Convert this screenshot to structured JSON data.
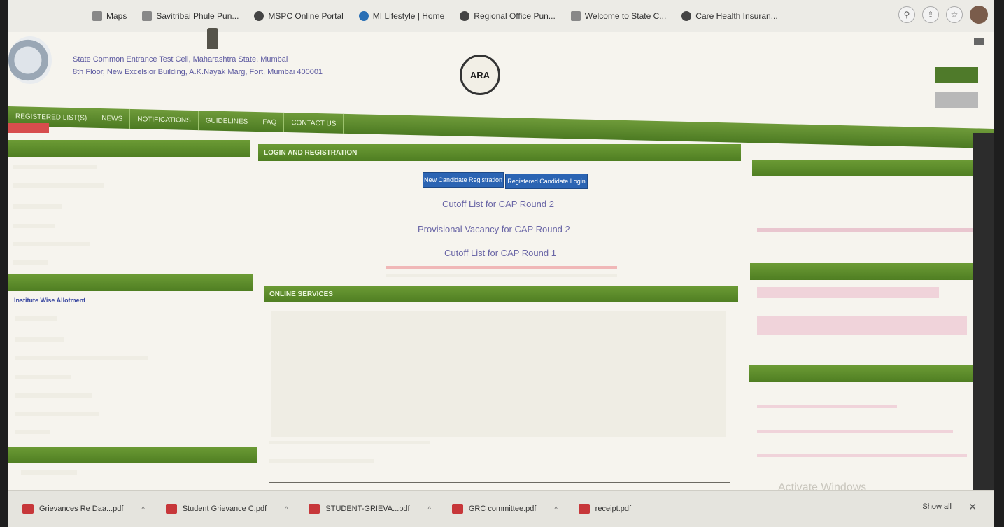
{
  "bookmarks": [
    {
      "label": "Maps",
      "icon": "maps-icon"
    },
    {
      "label": "Savitribai Phule Pun...",
      "icon": "university-icon"
    },
    {
      "label": "MSPC Online Portal",
      "icon": "globe-icon"
    },
    {
      "label": "MI Lifestyle | Home",
      "icon": "lifestyle-icon"
    },
    {
      "label": "Regional Office Pun...",
      "icon": "globe-icon"
    },
    {
      "label": "Welcome to State C...",
      "icon": "government-icon"
    },
    {
      "label": "Care Health Insuran...",
      "icon": "globe-icon"
    }
  ],
  "header": {
    "line1": "State Common Entrance Test Cell, Maharashtra State, Mumbai",
    "line2": "8th Floor, New Excelsior Building, A.K.Nayak Marg, Fort, Mumbai 400001",
    "line3": "",
    "logo_text": "ARA"
  },
  "nav": [
    "REGISTERED LIST(S)",
    "NEWS",
    "NOTIFICATIONS",
    "GUIDELINES",
    "FAQ",
    "CONTACT US"
  ],
  "panels": {
    "login_title": "LOGIN AND REGISTRATION",
    "btn_new": "New Candidate Registration",
    "btn_registered": "Registered Candidate Login",
    "cutoff_round2": "Cutoff List for CAP Round 2",
    "provisional_vacancy": "Provisional Vacancy for CAP Round 2",
    "cutoff_round1": "Cutoff List for CAP Round 1",
    "online_section": "ONLINE SERVICES"
  },
  "left_sidebar": {
    "institute_wise": "Institute Wise Allotment"
  },
  "downloads": [
    {
      "label": "Grievances Re Daa...pdf"
    },
    {
      "label": "Student Grievance C.pdf"
    },
    {
      "label": "STUDENT-GRIEVA...pdf"
    },
    {
      "label": "GRC committee.pdf"
    },
    {
      "label": "receipt.pdf"
    }
  ],
  "show_all": "Show all",
  "watermark": "Activate Windows"
}
